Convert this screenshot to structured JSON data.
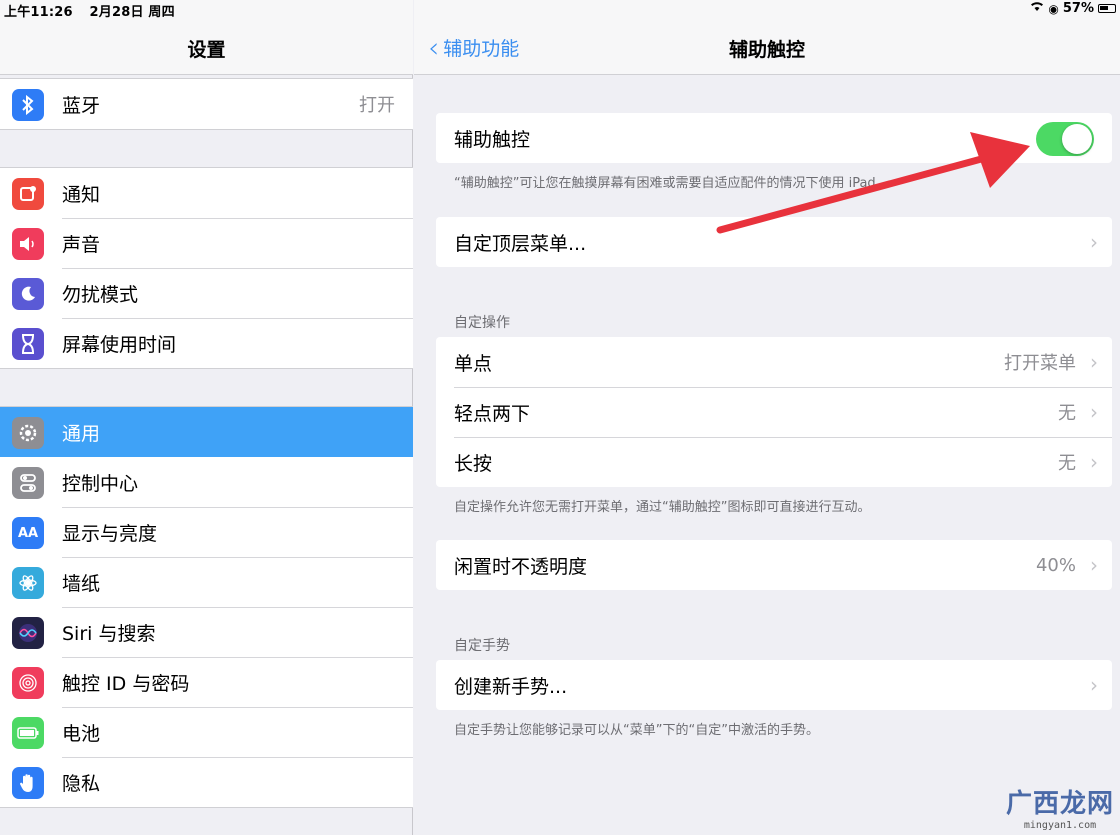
{
  "status_bar": {
    "time": "上午11:26",
    "date": "2月28日 周四",
    "battery": "57%"
  },
  "sidebar": {
    "title": "设置",
    "groups": [
      [
        {
          "icon": "bluetooth-icon",
          "color": "#2e7cf6",
          "glyph": "ᛒ",
          "label": "蓝牙",
          "value": "打开"
        }
      ],
      [
        {
          "icon": "notifications-icon",
          "color": "#f04a3e",
          "glyph": "▣",
          "label": "通知"
        },
        {
          "icon": "sounds-icon",
          "color": "#f03c5c",
          "glyph": "◀",
          "label": "声音"
        },
        {
          "icon": "do-not-disturb-icon",
          "color": "#5a5ad6",
          "glyph": "☾",
          "label": "勿扰模式"
        },
        {
          "icon": "screen-time-icon",
          "color": "#5a4fcf",
          "glyph": "⧗",
          "label": "屏幕使用时间"
        }
      ],
      [
        {
          "icon": "general-gear-icon",
          "color": "#8e8e93",
          "glyph": "⚙",
          "label": "通用",
          "selected": true
        },
        {
          "icon": "control-center-icon",
          "color": "#8e8e93",
          "glyph": "◉",
          "label": "控制中心"
        },
        {
          "icon": "display-brightness-icon",
          "color": "#2e7cf6",
          "glyph": "AA",
          "label": "显示与亮度"
        },
        {
          "icon": "wallpaper-icon",
          "color": "#35aadc",
          "glyph": "❀",
          "label": "墙纸"
        },
        {
          "icon": "siri-icon",
          "color": "#222244",
          "glyph": "◎",
          "label": "Siri 与搜索"
        },
        {
          "icon": "touch-id-icon",
          "color": "#f03c5c",
          "glyph": "◌",
          "label": "触控 ID 与密码"
        },
        {
          "icon": "battery-icon",
          "color": "#4cd964",
          "glyph": "▬",
          "label": "电池"
        },
        {
          "icon": "privacy-hand-icon",
          "color": "#2e7cf6",
          "glyph": "✋",
          "label": "隐私"
        }
      ]
    ]
  },
  "detail": {
    "back_label": "辅助功能",
    "title": "辅助触控",
    "assistive_touch": {
      "label": "辅助触控",
      "enabled": true,
      "footnote": "“辅助触控”可让您在触摸屏幕有困难或需要自适应配件的情况下使用 iPad。"
    },
    "top_menu": {
      "label": "自定顶层菜单..."
    },
    "custom_actions": {
      "header": "自定操作",
      "rows": [
        {
          "label": "单点",
          "value": "打开菜单"
        },
        {
          "label": "轻点两下",
          "value": "无"
        },
        {
          "label": "长按",
          "value": "无"
        }
      ],
      "footnote": "自定操作允许您无需打开菜单，通过“辅助触控”图标即可直接进行互动。"
    },
    "idle_opacity": {
      "label": "闲置时不透明度",
      "value": "40%"
    },
    "custom_gestures": {
      "header": "自定手势",
      "create_label": "创建新手势...",
      "footnote": "自定手势让您能够记录可以从“菜单”下的“自定”中激活的手势。"
    }
  },
  "watermark": {
    "main": "广西龙网",
    "sub": "mingyan1.com"
  },
  "colors": {
    "accent": "#3a8ef0",
    "selected_row": "#3fa2f7",
    "toggle_on": "#4cd964",
    "annotation_arrow": "#e8323c"
  }
}
